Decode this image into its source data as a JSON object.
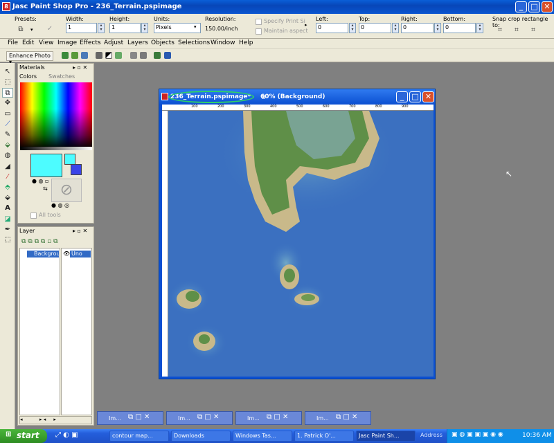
{
  "app": {
    "title": "Jasc Paint Shop Pro - 236_Terrain.pspimage",
    "icon_text": "8"
  },
  "window_controls": {
    "minimize": "_",
    "maximize": "□",
    "close": "✕"
  },
  "options": {
    "presets_label": "Presets:",
    "width_label": "Width:",
    "width_value": "1",
    "height_label": "Height:",
    "height_value": "1",
    "units_label": "Units:",
    "units_value": "Pixels",
    "resolution_label": "Resolution:",
    "resolution_value": "150.00/inch",
    "specify_print": "Specify Print Si",
    "maintain_aspect": "Maintain aspect",
    "left_label": "Left:",
    "left_value": "0",
    "top_label": "Top:",
    "top_value": "0",
    "right_label": "Right:",
    "right_value": "0",
    "bottom_label": "Bottom:",
    "bottom_value": "0",
    "snap_label": "Snap crop rectangle to:"
  },
  "menu": [
    "File",
    "Edit",
    "View",
    "Image",
    "Effects",
    "Adjust",
    "Layers",
    "Objects",
    "Selections",
    "Window",
    "Help"
  ],
  "toolbar2": {
    "enhance": "Enhance Photo"
  },
  "materials": {
    "title": "Materials",
    "tab_colors": "Colors",
    "tab_swatches": "Swatches",
    "fg_color": "#4dfcff",
    "bg_color": "#3a44e8",
    "all_tools": "All tools"
  },
  "layer": {
    "title": "Layer",
    "layer_name": "Backgrou",
    "vis_name": "Uno"
  },
  "image_window": {
    "filename": "236_Terrain.pspimage*",
    "zoom_info": "60% (Background)",
    "ruler_top": [
      "100",
      "200",
      "300",
      "400",
      "500",
      "600",
      "700",
      "800",
      "900"
    ]
  },
  "minimized": [
    "Im...",
    "Im...",
    "Im...",
    "Im..."
  ],
  "taskbar": {
    "start": "start",
    "tasks": [
      "contour map...",
      "Downloads",
      "Windows Tas...",
      "1. Patrick O'...",
      "Jasc Paint Sh..."
    ],
    "address": "Address",
    "clock": "10:36 AM"
  },
  "colors": {
    "annotation_ellipse": "#2fcf6a"
  }
}
